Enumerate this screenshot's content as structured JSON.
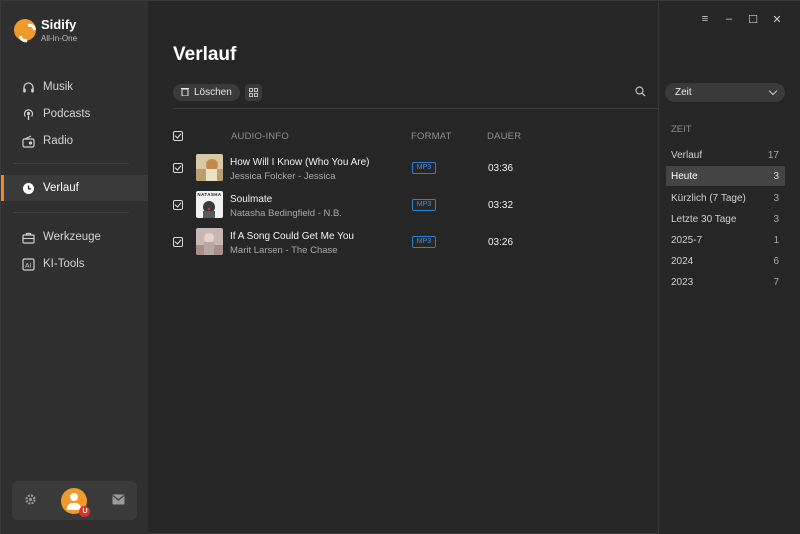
{
  "brand": {
    "name": "Sidify",
    "subtitle": "All-In-One",
    "accent": "#f08a24"
  },
  "sidebar": {
    "items": [
      {
        "label": "Musik",
        "icon": "headphones-icon"
      },
      {
        "label": "Podcasts",
        "icon": "podcast-icon"
      },
      {
        "label": "Radio",
        "icon": "radio-icon"
      },
      {
        "label": "Verlauf",
        "icon": "clock-icon",
        "active": true
      },
      {
        "label": "Werkzeuge",
        "icon": "toolbox-icon"
      },
      {
        "label": "KI-Tools",
        "icon": "ai-icon"
      }
    ],
    "bottom": {
      "settings_icon": "gear-icon",
      "avatar_badge": "U",
      "mail_icon": "mail-icon"
    }
  },
  "main": {
    "title": "Verlauf",
    "delete_label": "Löschen",
    "columns": {
      "info": "AUDIO-INFO",
      "format": "FORMAT",
      "duration": "DAUER"
    },
    "rows": [
      {
        "title": "How Will I Know (Who You Are)",
        "artist": "Jessica Folcker - Jessica",
        "format": "MP3",
        "duration": "03:36"
      },
      {
        "title": "Soulmate",
        "artist": "Natasha Bedingfield - N.B.",
        "format": "MP3",
        "duration": "03:32",
        "thumb_text": "NATASHA"
      },
      {
        "title": "If A Song Could Get Me You",
        "artist": "Marit Larsen - The Chase",
        "format": "MP3",
        "duration": "03:26"
      }
    ]
  },
  "right": {
    "sort": "Zeit",
    "filter_header": "ZEIT",
    "filters": [
      {
        "label": "Verlauf",
        "count": "17"
      },
      {
        "label": "Heute",
        "count": "3",
        "active": true
      },
      {
        "label": "Kürzlich (7 Tage)",
        "count": "3"
      },
      {
        "label": "Letzte 30 Tage",
        "count": "3"
      },
      {
        "label": "2025-7",
        "count": "1"
      },
      {
        "label": "2024",
        "count": "6"
      },
      {
        "label": "2023",
        "count": "7"
      }
    ]
  }
}
